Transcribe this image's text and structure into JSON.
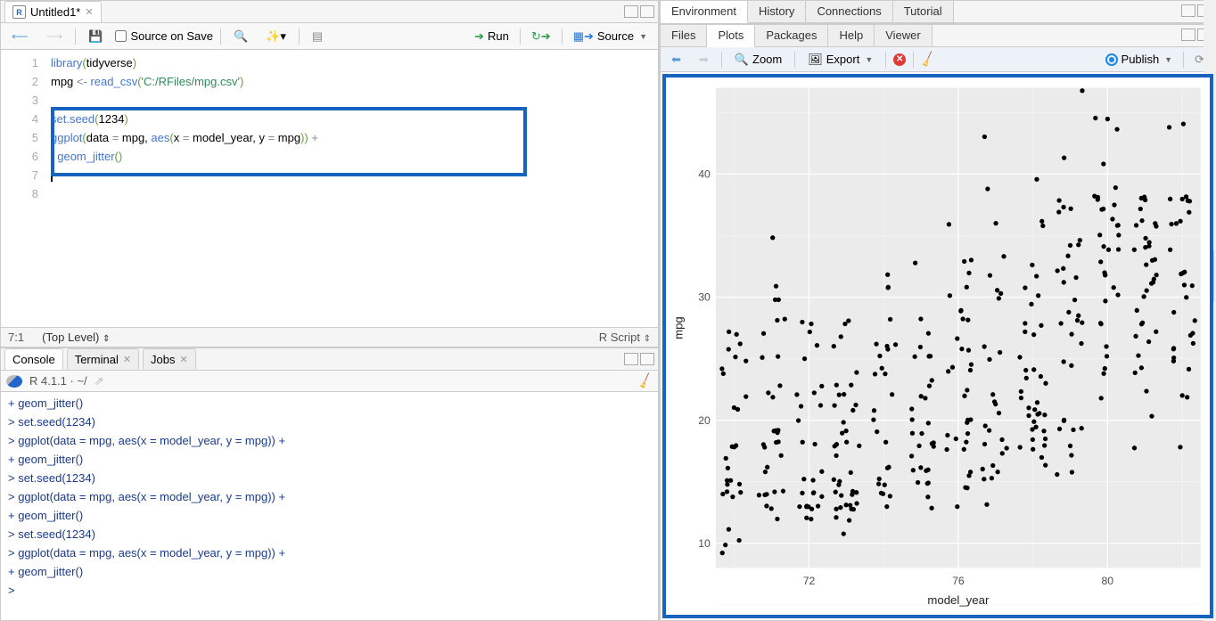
{
  "source": {
    "tab_title": "Untitled1*",
    "toolbar": {
      "source_on_save": "Source on Save",
      "run": "Run",
      "source": "Source"
    },
    "lines": [
      {
        "n": "1",
        "html": "<span class='fn'>library</span><span class='paren'>(</span>tidyverse<span class='paren'>)</span>"
      },
      {
        "n": "2",
        "html": "mpg <span class='op'>&lt;-</span> <span class='fn'>read_csv</span><span class='paren'>(</span><span class='str'>'C:/RFiles/mpg.csv'</span><span class='paren'>)</span>"
      },
      {
        "n": "3",
        "html": ""
      },
      {
        "n": "4",
        "html": "<span class='fn'>set.seed</span><span class='paren'>(</span>1234<span class='paren'>)</span>"
      },
      {
        "n": "5",
        "html": "<span class='fn'>ggplot</span><span class='paren'>(</span>data <span class='op'>=</span> mpg, <span class='fn'>aes</span><span class='paren'>(</span>x <span class='op'>=</span> model_year, y <span class='op'>=</span> mpg<span class='paren'>))</span> <span class='op'>+</span>"
      },
      {
        "n": "6",
        "html": "  <span class='fn'>geom_jitter</span><span class='paren'>()</span>"
      },
      {
        "n": "7",
        "html": "<span class='cursor'></span>"
      },
      {
        "n": "8",
        "html": ""
      }
    ],
    "status_pos": "7:1",
    "status_scope": "(Top Level)",
    "status_type": "R Script"
  },
  "console": {
    "tabs": [
      "Console",
      "Terminal",
      "Jobs"
    ],
    "info": "R 4.1.1 · ~/",
    "lines": [
      "+   geom_jitter()",
      "> set.seed(1234)",
      "> ggplot(data = mpg, aes(x = model_year, y = mpg)) +",
      "+   geom_jitter()",
      "> set.seed(1234)",
      "> ggplot(data = mpg, aes(x = model_year, y = mpg)) +",
      "+   geom_jitter()",
      "> set.seed(1234)",
      "> ggplot(data = mpg, aes(x = model_year, y = mpg)) +",
      "+   geom_jitter()",
      "> "
    ]
  },
  "env_tabs": [
    "Environment",
    "History",
    "Connections",
    "Tutorial"
  ],
  "plot_tabs": [
    "Files",
    "Plots",
    "Packages",
    "Help",
    "Viewer"
  ],
  "plot_toolbar": {
    "zoom": "Zoom",
    "export": "Export",
    "publish": "Publish"
  },
  "chart_data": {
    "type": "scatter",
    "title": "",
    "xlabel": "model_year",
    "ylabel": "mpg",
    "xlim": [
      69.5,
      82.5
    ],
    "ylim": [
      8,
      47
    ],
    "x_ticks": [
      72,
      76,
      80
    ],
    "y_ticks": [
      10,
      20,
      30,
      40
    ],
    "note": "jittered scatter; points approximate integer model_year 70–82, mpg ~9–46",
    "points": [
      [
        70,
        18
      ],
      [
        70,
        15
      ],
      [
        70,
        18
      ],
      [
        70,
        16
      ],
      [
        70,
        17
      ],
      [
        70,
        15
      ],
      [
        70,
        14
      ],
      [
        70,
        14
      ],
      [
        70,
        14
      ],
      [
        70,
        15
      ],
      [
        70,
        15
      ],
      [
        70,
        14
      ],
      [
        70,
        24
      ],
      [
        70,
        22
      ],
      [
        70,
        18
      ],
      [
        70,
        21
      ],
      [
        70,
        27
      ],
      [
        70,
        26
      ],
      [
        70,
        25
      ],
      [
        70,
        24
      ],
      [
        70,
        25
      ],
      [
        70,
        26
      ],
      [
        70,
        21
      ],
      [
        70,
        10
      ],
      [
        70,
        10
      ],
      [
        70,
        11
      ],
      [
        70,
        9
      ],
      [
        70,
        27
      ],
      [
        71,
        22
      ],
      [
        71,
        14
      ],
      [
        71,
        16
      ],
      [
        71,
        18
      ],
      [
        71,
        19
      ],
      [
        71,
        25
      ],
      [
        71,
        27
      ],
      [
        71,
        28
      ],
      [
        71,
        25
      ],
      [
        71,
        19
      ],
      [
        71,
        16
      ],
      [
        71,
        17
      ],
      [
        71,
        19
      ],
      [
        71,
        18
      ],
      [
        71,
        14
      ],
      [
        71,
        14
      ],
      [
        71,
        14
      ],
      [
        71,
        14
      ],
      [
        71,
        12
      ],
      [
        71,
        13
      ],
      [
        71,
        13
      ],
      [
        71,
        18
      ],
      [
        71,
        22
      ],
      [
        71,
        19
      ],
      [
        71,
        18
      ],
      [
        71,
        23
      ],
      [
        71,
        28
      ],
      [
        71,
        30
      ],
      [
        71,
        30
      ],
      [
        71,
        31
      ],
      [
        71,
        35
      ],
      [
        72,
        25
      ],
      [
        72,
        16
      ],
      [
        72,
        13
      ],
      [
        72,
        14
      ],
      [
        72,
        15
      ],
      [
        72,
        18
      ],
      [
        72,
        22
      ],
      [
        72,
        21
      ],
      [
        72,
        26
      ],
      [
        72,
        22
      ],
      [
        72,
        28
      ],
      [
        72,
        23
      ],
      [
        72,
        28
      ],
      [
        72,
        27
      ],
      [
        72,
        13
      ],
      [
        72,
        14
      ],
      [
        72,
        13
      ],
      [
        72,
        14
      ],
      [
        72,
        15
      ],
      [
        72,
        12
      ],
      [
        72,
        13
      ],
      [
        72,
        13
      ],
      [
        72,
        14
      ],
      [
        72,
        13
      ],
      [
        72,
        12
      ],
      [
        72,
        18
      ],
      [
        72,
        20
      ],
      [
        72,
        21
      ],
      [
        73,
        13
      ],
      [
        73,
        14
      ],
      [
        73,
        15
      ],
      [
        73,
        14
      ],
      [
        73,
        17
      ],
      [
        73,
        11
      ],
      [
        73,
        13
      ],
      [
        73,
        12
      ],
      [
        73,
        13
      ],
      [
        73,
        19
      ],
      [
        73,
        15
      ],
      [
        73,
        13
      ],
      [
        73,
        13
      ],
      [
        73,
        14
      ],
      [
        73,
        18
      ],
      [
        73,
        22
      ],
      [
        73,
        21
      ],
      [
        73,
        26
      ],
      [
        73,
        22
      ],
      [
        73,
        28
      ],
      [
        73,
        23
      ],
      [
        73,
        28
      ],
      [
        73,
        27
      ],
      [
        73,
        13
      ],
      [
        73,
        14
      ],
      [
        73,
        13
      ],
      [
        73,
        14
      ],
      [
        73,
        15
      ],
      [
        73,
        12
      ],
      [
        73,
        18
      ],
      [
        73,
        20
      ],
      [
        73,
        21
      ],
      [
        73,
        19
      ],
      [
        73,
        21
      ],
      [
        73,
        16
      ],
      [
        73,
        18
      ],
      [
        73,
        18
      ],
      [
        73,
        23
      ],
      [
        73,
        24
      ],
      [
        74,
        20
      ],
      [
        74,
        21
      ],
      [
        74,
        22
      ],
      [
        74,
        24
      ],
      [
        74,
        25
      ],
      [
        74,
        26
      ],
      [
        74,
        26
      ],
      [
        74,
        31
      ],
      [
        74,
        32
      ],
      [
        74,
        28
      ],
      [
        74,
        24
      ],
      [
        74,
        26
      ],
      [
        74,
        24
      ],
      [
        74,
        26
      ],
      [
        74,
        31
      ],
      [
        74,
        19
      ],
      [
        74,
        18
      ],
      [
        74,
        15
      ],
      [
        74,
        15
      ],
      [
        74,
        16
      ],
      [
        74,
        15
      ],
      [
        74,
        16
      ],
      [
        74,
        14
      ],
      [
        74,
        13
      ],
      [
        74,
        14
      ],
      [
        74,
        14
      ],
      [
        75,
        18
      ],
      [
        75,
        15
      ],
      [
        75,
        16
      ],
      [
        75,
        14
      ],
      [
        75,
        17
      ],
      [
        75,
        13
      ],
      [
        75,
        16
      ],
      [
        75,
        20
      ],
      [
        75,
        21
      ],
      [
        75,
        18
      ],
      [
        75,
        19
      ],
      [
        75,
        23
      ],
      [
        75,
        23
      ],
      [
        75,
        22
      ],
      [
        75,
        25
      ],
      [
        75,
        33
      ],
      [
        75,
        28
      ],
      [
        75,
        25
      ],
      [
        75,
        25
      ],
      [
        75,
        26
      ],
      [
        75,
        27
      ],
      [
        75,
        18
      ],
      [
        75,
        20
      ],
      [
        75,
        19
      ],
      [
        75,
        18
      ],
      [
        75,
        15
      ],
      [
        75,
        15
      ],
      [
        75,
        16
      ],
      [
        75,
        16
      ],
      [
        75,
        22
      ],
      [
        76,
        24
      ],
      [
        76,
        20
      ],
      [
        76,
        17.5
      ],
      [
        76,
        29
      ],
      [
        76,
        32
      ],
      [
        76,
        28
      ],
      [
        76,
        26.5
      ],
      [
        76,
        20
      ],
      [
        76,
        13
      ],
      [
        76,
        19
      ],
      [
        76,
        19
      ],
      [
        76,
        31
      ],
      [
        76,
        36
      ],
      [
        76,
        33
      ],
      [
        76,
        24.5
      ],
      [
        76,
        26
      ],
      [
        76,
        25.5
      ],
      [
        76,
        30
      ],
      [
        76,
        28
      ],
      [
        76,
        24
      ],
      [
        76,
        22.5
      ],
      [
        76,
        29
      ],
      [
        76,
        24.5
      ],
      [
        76,
        29
      ],
      [
        76,
        33
      ],
      [
        76,
        20
      ],
      [
        76,
        18
      ],
      [
        76,
        18.5
      ],
      [
        76,
        17.5
      ],
      [
        76,
        14.5
      ],
      [
        76,
        16
      ],
      [
        76,
        15.5
      ],
      [
        76,
        14.5
      ],
      [
        76,
        22
      ],
      [
        77,
        17.5
      ],
      [
        77,
        15.5
      ],
      [
        77,
        15
      ],
      [
        77,
        17.5
      ],
      [
        77,
        20.5
      ],
      [
        77,
        19
      ],
      [
        77,
        18.5
      ],
      [
        77,
        16
      ],
      [
        77,
        25.5
      ],
      [
        77,
        30.5
      ],
      [
        77,
        33.5
      ],
      [
        77,
        30
      ],
      [
        77,
        30.5
      ],
      [
        77,
        22
      ],
      [
        77,
        21.5
      ],
      [
        77,
        21.5
      ],
      [
        77,
        43
      ],
      [
        77,
        36
      ],
      [
        77,
        32
      ],
      [
        77,
        39
      ],
      [
        77,
        19.5
      ],
      [
        77,
        16.5
      ],
      [
        77,
        18
      ],
      [
        77,
        16
      ],
      [
        77,
        13
      ],
      [
        77,
        26
      ],
      [
        77,
        25
      ],
      [
        78,
        19.2
      ],
      [
        78,
        18.2
      ],
      [
        78,
        17.5
      ],
      [
        78,
        18
      ],
      [
        78,
        20.5
      ],
      [
        78,
        19.4
      ],
      [
        78,
        20.6
      ],
      [
        78,
        18.6
      ],
      [
        78,
        18.1
      ],
      [
        78,
        19.2
      ],
      [
        78,
        30
      ],
      [
        78,
        27.5
      ],
      [
        78,
        27.2
      ],
      [
        78,
        30.9
      ],
      [
        78,
        21.1
      ],
      [
        78,
        23.2
      ],
      [
        78,
        23.8
      ],
      [
        78,
        23.9
      ],
      [
        78,
        20.3
      ],
      [
        78,
        17
      ],
      [
        78,
        21.6
      ],
      [
        78,
        16.2
      ],
      [
        78,
        31.5
      ],
      [
        78,
        29.5
      ],
      [
        78,
        21.5
      ],
      [
        78,
        19.8
      ],
      [
        78,
        22.3
      ],
      [
        78,
        20.2
      ],
      [
        78,
        36
      ],
      [
        78,
        27
      ],
      [
        78,
        21
      ],
      [
        78,
        23
      ],
      [
        78,
        24
      ],
      [
        78,
        25
      ],
      [
        78,
        28
      ],
      [
        78,
        32.8
      ],
      [
        78,
        39.4
      ],
      [
        78,
        36.1
      ],
      [
        79,
        19.9
      ],
      [
        79,
        19.4
      ],
      [
        79,
        20.2
      ],
      [
        79,
        19.2
      ],
      [
        79,
        25
      ],
      [
        79,
        28
      ],
      [
        79,
        34.2
      ],
      [
        79,
        34.5
      ],
      [
        79,
        31.8
      ],
      [
        79,
        37.3
      ],
      [
        79,
        28.4
      ],
      [
        79,
        28.8
      ],
      [
        79,
        26.8
      ],
      [
        79,
        33.5
      ],
      [
        79,
        41.5
      ],
      [
        79,
        38.1
      ],
      [
        79,
        32.1
      ],
      [
        79,
        37.2
      ],
      [
        79,
        28
      ],
      [
        79,
        26.4
      ],
      [
        79,
        24.3
      ],
      [
        79,
        19.1
      ],
      [
        79,
        34.3
      ],
      [
        79,
        29.8
      ],
      [
        79,
        31.3
      ],
      [
        79,
        37
      ],
      [
        79,
        32.2
      ],
      [
        79,
        46.6
      ],
      [
        79,
        27.9
      ],
      [
        79,
        16
      ],
      [
        79,
        17
      ],
      [
        79,
        18
      ],
      [
        79,
        15.5
      ],
      [
        80,
        40.8
      ],
      [
        80,
        44.3
      ],
      [
        80,
        43.4
      ],
      [
        80,
        36.4
      ],
      [
        80,
        30
      ],
      [
        80,
        44.6
      ],
      [
        80,
        33.8
      ],
      [
        80,
        29.8
      ],
      [
        80,
        32.7
      ],
      [
        80,
        23.7
      ],
      [
        80,
        35
      ],
      [
        80,
        32
      ],
      [
        80,
        37
      ],
      [
        80,
        37.7
      ],
      [
        80,
        34.2
      ],
      [
        80,
        35.1
      ],
      [
        80,
        28
      ],
      [
        80,
        24
      ],
      [
        80,
        37
      ],
      [
        80,
        31
      ],
      [
        80,
        36
      ],
      [
        80,
        36
      ],
      [
        80,
        34
      ],
      [
        80,
        38
      ],
      [
        80,
        32
      ],
      [
        80,
        38
      ],
      [
        80,
        25
      ],
      [
        80,
        38
      ],
      [
        80,
        26
      ],
      [
        80,
        22
      ],
      [
        80,
        32
      ],
      [
        80,
        28
      ],
      [
        80,
        39
      ],
      [
        81,
        34.7
      ],
      [
        81,
        34.4
      ],
      [
        81,
        29.9
      ],
      [
        81,
        33
      ],
      [
        81,
        33.7
      ],
      [
        81,
        32.4
      ],
      [
        81,
        32.9
      ],
      [
        81,
        31.6
      ],
      [
        81,
        28.1
      ],
      [
        81,
        30.7
      ],
      [
        81,
        25.4
      ],
      [
        81,
        24.2
      ],
      [
        81,
        22.4
      ],
      [
        81,
        26.6
      ],
      [
        81,
        20.2
      ],
      [
        81,
        17.6
      ],
      [
        81,
        28
      ],
      [
        81,
        27
      ],
      [
        81,
        34
      ],
      [
        81,
        31
      ],
      [
        81,
        29
      ],
      [
        81,
        27
      ],
      [
        81,
        24
      ],
      [
        81,
        36
      ],
      [
        81,
        37
      ],
      [
        81,
        31
      ],
      [
        81,
        38
      ],
      [
        81,
        36
      ],
      [
        81,
        36
      ],
      [
        81,
        36
      ],
      [
        81,
        34
      ],
      [
        81,
        38
      ],
      [
        81,
        32
      ],
      [
        81,
        38
      ],
      [
        82,
        25
      ],
      [
        82,
        38
      ],
      [
        82,
        26
      ],
      [
        82,
        22
      ],
      [
        82,
        32
      ],
      [
        82,
        36
      ],
      [
        82,
        27
      ],
      [
        82,
        27
      ],
      [
        82,
        44
      ],
      [
        82,
        32
      ],
      [
        82,
        28
      ],
      [
        82,
        31
      ],
      [
        82,
        24
      ],
      [
        82,
        26
      ],
      [
        82,
        36
      ],
      [
        82,
        34
      ],
      [
        82,
        38
      ],
      [
        82,
        32
      ],
      [
        82,
        38
      ],
      [
        82,
        25
      ],
      [
        82,
        38
      ],
      [
        82,
        26
      ],
      [
        82,
        30
      ],
      [
        82,
        22
      ],
      [
        82,
        29
      ],
      [
        82,
        31
      ],
      [
        82,
        18
      ],
      [
        82,
        37
      ],
      [
        82,
        36
      ],
      [
        82,
        38
      ],
      [
        82,
        44
      ]
    ]
  }
}
